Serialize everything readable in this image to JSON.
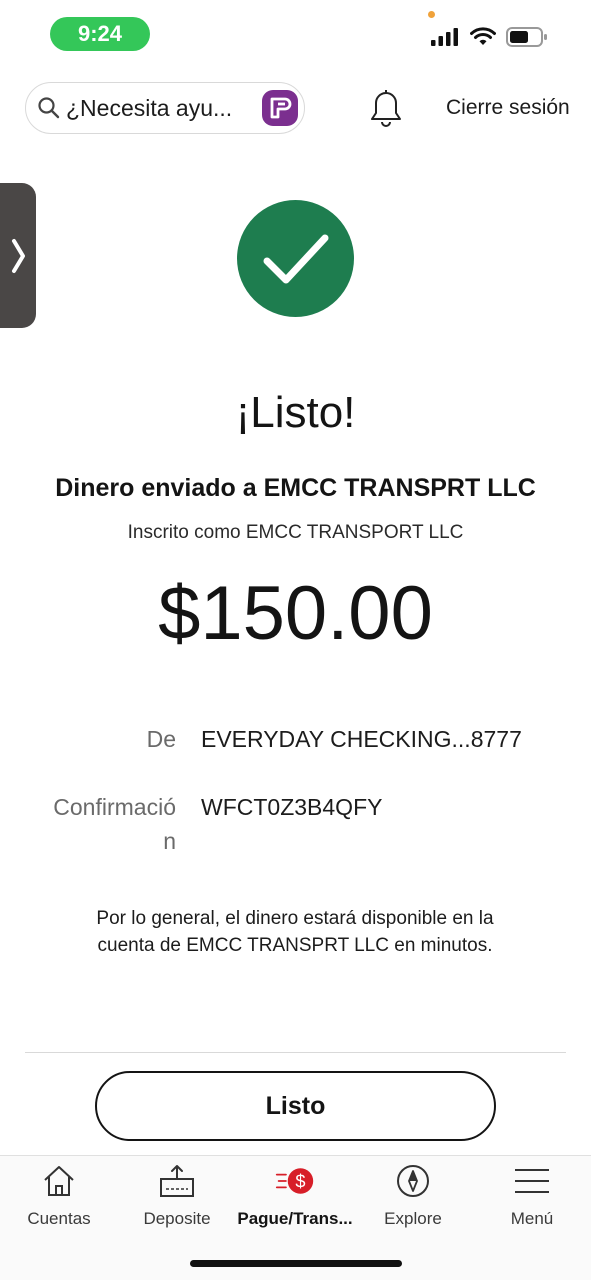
{
  "status_bar": {
    "time": "9:24",
    "icons": [
      "signal-icon",
      "wifi-icon",
      "battery-icon"
    ]
  },
  "header": {
    "search_placeholder": "¿Necesita ayu...",
    "assistant_icon": "assistant-icon",
    "bell_icon": "bell-icon",
    "logout_label": "Cierre sesión"
  },
  "confirmation": {
    "title": "¡Listo!",
    "sent_to": "Dinero enviado a EMCC TRANSPRT LLC",
    "enrolled_as": "Inscrito como EMCC TRANSPORT LLC",
    "amount": "$150.00",
    "details": [
      {
        "label": "De",
        "value": "EVERYDAY CHECKING...8777"
      },
      {
        "label": "Confirmació\nn",
        "value": "WFCT0Z3B4QFY"
      }
    ],
    "note": "Por lo general, el dinero estará disponible en la cuenta de EMCC TRANSPRT LLC en minutos."
  },
  "done_button_label": "Listo",
  "tab_bar": {
    "tabs": [
      {
        "label": "Cuentas",
        "icon": "home-icon",
        "active": false
      },
      {
        "label": "Deposite",
        "icon": "deposit-icon",
        "active": false
      },
      {
        "label": "Pague/Trans...",
        "icon": "pay-transfer-icon",
        "active": true
      },
      {
        "label": "Explore",
        "icon": "compass-icon",
        "active": false
      },
      {
        "label": "Menú",
        "icon": "menu-icon",
        "active": false
      }
    ]
  },
  "colors": {
    "success_green": "#1e7d4f",
    "status_green": "#34c759",
    "assistant_purple": "#7b2f8f",
    "pay_red": "#d71e28"
  }
}
